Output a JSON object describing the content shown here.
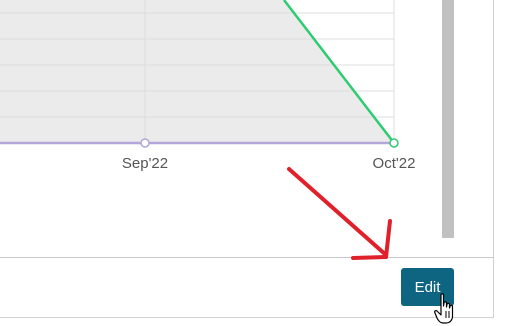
{
  "chart_data": {
    "type": "area",
    "categories": [
      "Sep'22",
      "Oct'22"
    ],
    "series": [
      {
        "values": [
          null,
          0
        ],
        "color": "#2ecc71"
      },
      {
        "values": [
          0,
          0
        ],
        "color": "#b3a6d9"
      }
    ],
    "x_tick_labels": [
      "Sep'22",
      "Oct'22"
    ],
    "area_fill": "#ecebeb",
    "grid": true
  },
  "footer": {
    "edit_label": "Edit"
  },
  "colors": {
    "button_bg": "#0d6582",
    "annotation_arrow": "#e0202a",
    "grid": "#dcdcdc",
    "scrollbar": "#c1c1c1"
  }
}
